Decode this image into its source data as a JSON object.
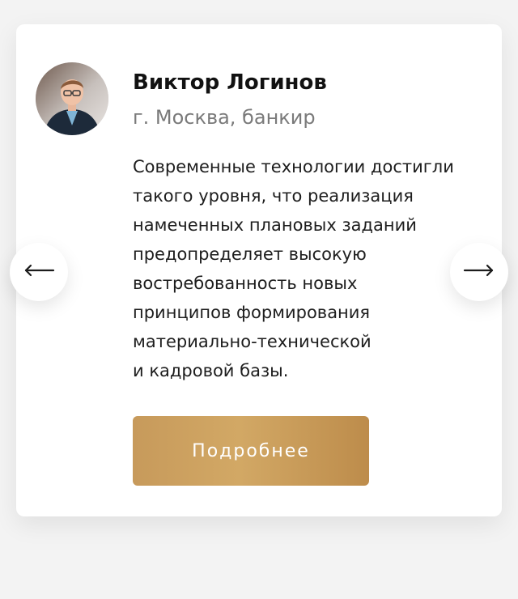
{
  "testimonial": {
    "name": "Виктор Логинов",
    "subtitle": "г. Москва, банкир",
    "quote_lines": [
      "Современные технологии достигли",
      "такого уровня, что реализация",
      "намеченных плановых заданий",
      "предопределяет высокую",
      "востребованность новых",
      "принципов формирования",
      "материально-технической",
      "и кадровой базы."
    ],
    "button_label": "Подробнее",
    "accent_color": "#c79a5b"
  },
  "icons": {
    "prev": "arrow-left-icon",
    "next": "arrow-right-icon"
  }
}
